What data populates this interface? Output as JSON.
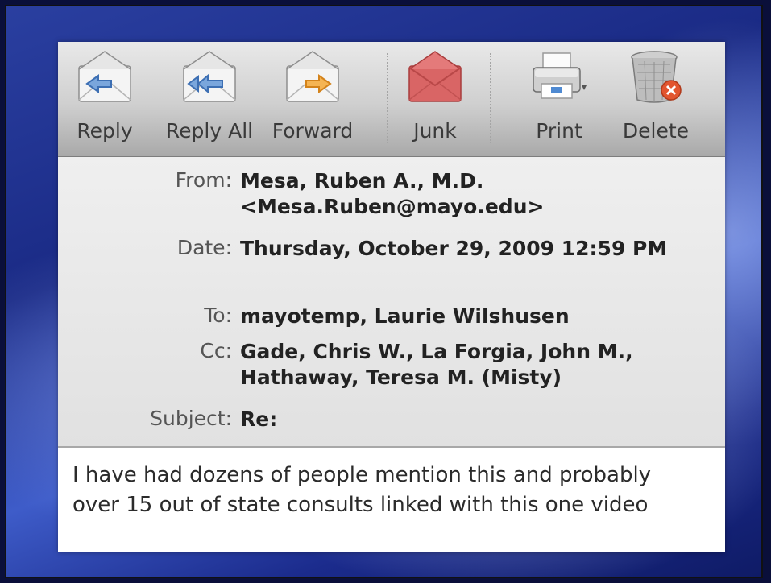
{
  "toolbar": {
    "reply": "Reply",
    "reply_all": "Reply All",
    "forward": "Forward",
    "junk": "Junk",
    "print": "Print",
    "delete": "Delete"
  },
  "headers": {
    "from_label": "From:",
    "from_name": "Mesa, Ruben A., M.D.",
    "from_email": "<Mesa.Ruben@mayo.edu>",
    "date_label": "Date:",
    "date_value": "Thursday, October 29, 2009 12:59 PM",
    "to_label": "To:",
    "to_value": "mayotemp, Laurie Wilshusen",
    "cc_label": "Cc:",
    "cc_value": "Gade, Chris W., La Forgia, John M., Hathaway, Teresa M. (Misty)",
    "subject_label": "Subject:",
    "subject_value": "Re:"
  },
  "body": {
    "line1": "I have had dozens of people mention this and probably",
    "line2": "over 15 out of state consults linked with this one video"
  },
  "icons": {
    "reply": "reply-envelope-icon",
    "reply_all": "reply-all-envelope-icon",
    "forward": "forward-envelope-icon",
    "junk": "junk-envelope-icon",
    "print": "printer-icon",
    "delete": "trash-can-icon"
  },
  "colors": {
    "reply_arrow": "#4b7fc4",
    "forward_arrow": "#f0a030",
    "junk": "#d85a5a",
    "delete_badge": "#e2552f"
  }
}
